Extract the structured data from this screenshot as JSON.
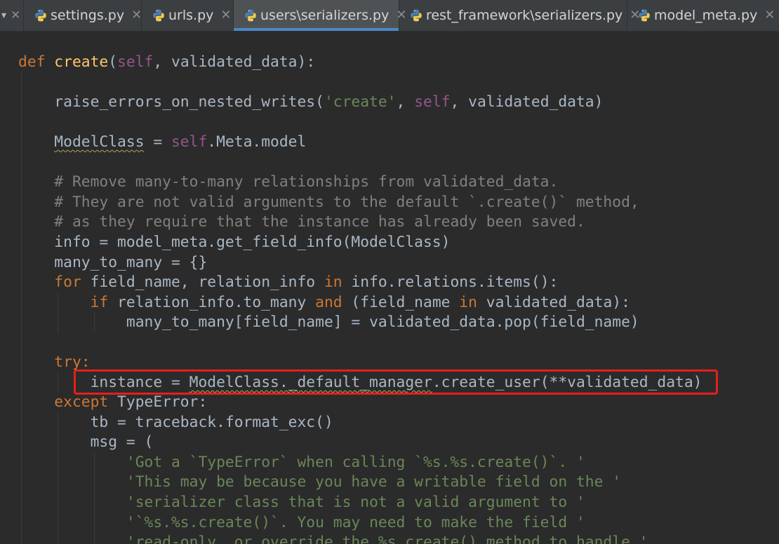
{
  "tabs": [
    {
      "label": "settings.py",
      "active": false
    },
    {
      "label": "urls.py",
      "active": false
    },
    {
      "label": "users\\serializers.py",
      "active": true
    },
    {
      "label": "rest_framework\\serializers.py",
      "active": false
    },
    {
      "label": "model_meta.py",
      "active": false
    }
  ],
  "colors": {
    "background": "#2b2b2b",
    "keyword": "#cc7832",
    "function": "#ffc66d",
    "self": "#94558d",
    "string": "#6a8759",
    "comment": "#808080",
    "text": "#a9b7c6",
    "active_tab_underline": "#4a88c7",
    "highlight_box": "#e3201b"
  },
  "code": {
    "l1": {
      "kw": "def",
      "fn": "create",
      "p1": "(",
      "self": "self",
      "p2": ", validated_data):"
    },
    "l2": {
      "a": "raise_errors_on_nested_writes(",
      "s": "'create'",
      "b": ", ",
      "self": "self",
      "c": ", validated_data)"
    },
    "l3": {
      "a": "ModelClass",
      "b": " = ",
      "self": "self",
      "c": ".Meta.model"
    },
    "l4": {
      "cm": "# Remove many-to-many relationships from validated_data."
    },
    "l5": {
      "cm": "# They are not valid arguments to the default `.create()` method,"
    },
    "l6": {
      "cm": "# as they require that the instance has already been saved."
    },
    "l7": {
      "a": "info = model_meta.get_field_info(ModelClass)"
    },
    "l8": {
      "a": "many_to_many = {}"
    },
    "l9": {
      "kw1": "for",
      "a": " field_name, relation_info ",
      "kw2": "in",
      "b": " info.relations.items():"
    },
    "l10": {
      "kw1": "if",
      "a": " relation_info.to_many ",
      "kw2": "and",
      "b": " (field_name ",
      "kw3": "in",
      "c": " validated_data):"
    },
    "l11": {
      "a": "many_to_many[field_name] = validated_data.pop(field_name)"
    },
    "l12": {
      "kw": "try",
      "a": ":"
    },
    "l13": {
      "a": "instance = ",
      "b": "ModelClass._default_manager",
      "c": ".create_user(**validated_data)"
    },
    "l14": {
      "kw": "except",
      "a": " TypeError:"
    },
    "l15": {
      "a": "tb = traceback.format_exc()"
    },
    "l16": {
      "a": "msg = ("
    },
    "l17": {
      "s": "'Got a `TypeError` when calling `%s.%s.create()`. '"
    },
    "l18": {
      "s": "'This may be because you have a writable field on the '"
    },
    "l19": {
      "s": "'serializer class that is not a valid argument to '"
    },
    "l20": {
      "s": "'`%s.%s.create()`. You may need to make the field '"
    },
    "l21": {
      "s": "'read-only, or override the %s.create() method to handle '"
    }
  }
}
